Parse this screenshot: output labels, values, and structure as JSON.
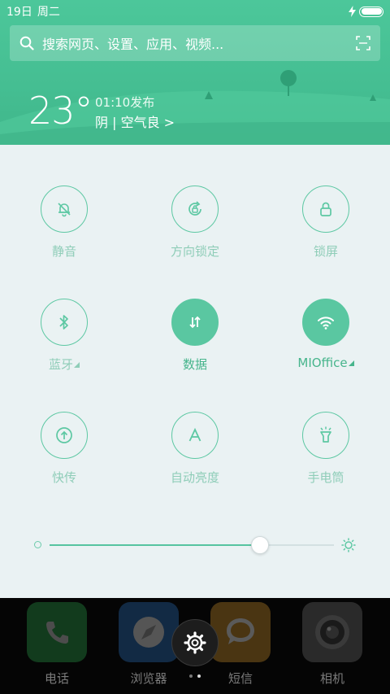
{
  "status_bar": {
    "date": "19日",
    "weekday": "周二"
  },
  "search": {
    "placeholder": "搜索网页、设置、应用、视频..."
  },
  "weather": {
    "temperature": "23°",
    "publish_time": "01:10发布",
    "condition": "阴 | 空气良 >"
  },
  "toggles": [
    {
      "label": "静音",
      "icon": "bell-off-icon",
      "on": false
    },
    {
      "label": "方向锁定",
      "icon": "rotation-lock-icon",
      "on": false
    },
    {
      "label": "锁屏",
      "icon": "lock-icon",
      "on": false
    },
    {
      "label": "蓝牙",
      "icon": "bluetooth-icon",
      "on": false
    },
    {
      "label": "数据",
      "icon": "mobile-data-icon",
      "on": true
    },
    {
      "label": "MIOffice",
      "icon": "wifi-icon",
      "on": true
    },
    {
      "label": "快传",
      "icon": "quick-transfer-icon",
      "on": false
    },
    {
      "label": "自动亮度",
      "icon": "auto-brightness-icon",
      "on": false
    },
    {
      "label": "手电筒",
      "icon": "flashlight-icon",
      "on": false
    }
  ],
  "brightness": {
    "level": 0.74
  },
  "dock": {
    "apps": [
      {
        "label": "电话",
        "icon": "phone-icon",
        "color": "#123b1d"
      },
      {
        "label": "浏览器",
        "icon": "browser-icon",
        "color": "#122a44"
      },
      {
        "label": "短信",
        "icon": "message-icon",
        "color": "#4a3512"
      },
      {
        "label": "相机",
        "icon": "camera-icon",
        "color": "#2a2a2a"
      }
    ]
  },
  "colors": {
    "accent": "#5ac7a1",
    "header": "#45be92"
  }
}
